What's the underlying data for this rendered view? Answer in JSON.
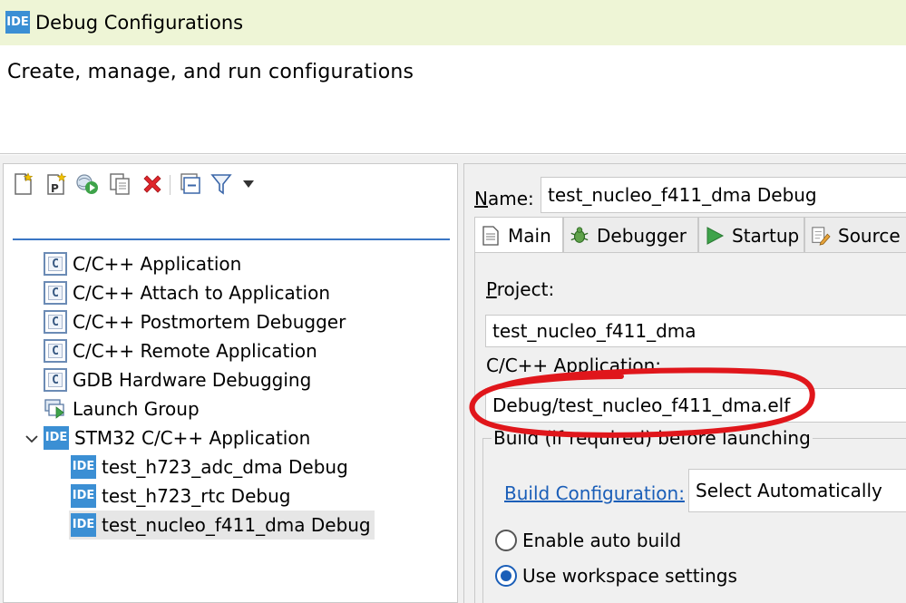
{
  "window": {
    "icon_text": "IDE",
    "title": "Debug Configurations"
  },
  "header": {
    "subtitle": "Create, manage, and run configurations"
  },
  "toolbar": {
    "icons": [
      "new-configuration-icon",
      "new-prototype-icon",
      "export-icon",
      "duplicate-icon",
      "delete-icon",
      "collapse-all-icon",
      "filter-icon",
      "view-menu-dropdown-icon"
    ]
  },
  "filter": {
    "value": ""
  },
  "tree": {
    "items": [
      {
        "label": "C/C++ Application",
        "icon": "c-config-icon",
        "icon_text": "C"
      },
      {
        "label": "C/C++ Attach to Application",
        "icon": "c-config-icon",
        "icon_text": "C"
      },
      {
        "label": "C/C++ Postmortem Debugger",
        "icon": "c-config-icon",
        "icon_text": "C"
      },
      {
        "label": "C/C++ Remote Application",
        "icon": "c-config-icon",
        "icon_text": "C"
      },
      {
        "label": "GDB Hardware Debugging",
        "icon": "c-config-icon",
        "icon_text": "C"
      },
      {
        "label": "Launch Group",
        "icon": "launch-group-icon"
      },
      {
        "label": "STM32 C/C++ Application",
        "icon": "ide-icon",
        "icon_text": "IDE",
        "expanded": true
      },
      {
        "label": "test_h723_adc_dma Debug",
        "icon": "ide-icon",
        "icon_text": "IDE"
      },
      {
        "label": "test_h723_rtc Debug",
        "icon": "ide-icon",
        "icon_text": "IDE"
      },
      {
        "label": "test_nucleo_f411_dma Debug",
        "icon": "ide-icon",
        "icon_text": "IDE",
        "selected": true
      }
    ]
  },
  "config": {
    "name_label_mnemonic": "N",
    "name_label_rest": "ame:",
    "name_value": "test_nucleo_f411_dma Debug",
    "tabs": [
      {
        "label": "Main",
        "icon": "main-tab-icon",
        "active": true
      },
      {
        "label": "Debugger",
        "icon": "debugger-tab-icon"
      },
      {
        "label": "Startup",
        "icon": "startup-tab-icon"
      },
      {
        "label": "Source",
        "icon": "source-tab-icon"
      }
    ],
    "project_label_mnemonic": "P",
    "project_label_rest": "roject:",
    "project_value": "test_nucleo_f411_dma",
    "app_label": "C/C++ Application:",
    "app_value": "Debug/test_nucleo_f411_dma.elf",
    "build_group_label": "Build (if required) before launching",
    "build_config_label": "Build Configuration:",
    "build_config_value": "Select Automatically",
    "radio_auto_build": "Enable auto build",
    "radio_workspace": "Use workspace settings",
    "selected_radio": "workspace"
  },
  "colors": {
    "titlebar_bg": "#eef5d6",
    "ide_blue": "#3b8fd4",
    "link_blue": "#1a5eb8",
    "annotation_red": "#e0161b"
  }
}
